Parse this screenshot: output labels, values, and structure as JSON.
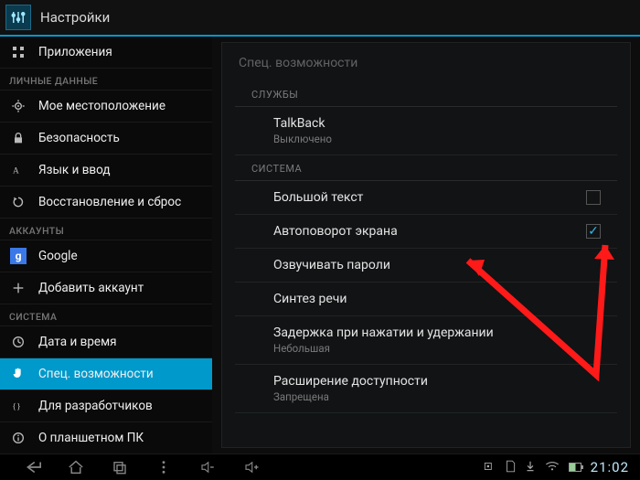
{
  "titlebar": {
    "title": "Настройки"
  },
  "sidebar": {
    "items": [
      {
        "label": "Приложения",
        "icon": "apps"
      }
    ],
    "section_personal": "ЛИЧНЫЕ ДАННЫЕ",
    "personal": [
      {
        "label": "Мое местоположение",
        "icon": "location"
      },
      {
        "label": "Безопасность",
        "icon": "lock"
      },
      {
        "label": "Язык и ввод",
        "icon": "lang"
      },
      {
        "label": "Восстановление и сброс",
        "icon": "reset"
      }
    ],
    "section_accounts": "АККАУНТЫ",
    "accounts": [
      {
        "label": "Google",
        "icon": "google"
      },
      {
        "label": "Добавить аккаунт",
        "icon": "plus"
      }
    ],
    "section_system": "СИСТЕМА",
    "system": [
      {
        "label": "Дата и время",
        "icon": "clock"
      },
      {
        "label": "Спец. возможности",
        "icon": "hand",
        "selected": true
      },
      {
        "label": "Для разработчиков",
        "icon": "dev"
      },
      {
        "label": "О планшетном ПК",
        "icon": "about"
      }
    ]
  },
  "content": {
    "page_title": "Спец. возможности",
    "section_services": "СЛУЖБЫ",
    "services": [
      {
        "primary": "TalkBack",
        "secondary": "Выключено"
      }
    ],
    "section_system": "СИСТЕМА",
    "system": [
      {
        "primary": "Большой текст",
        "checkbox": true,
        "checked": false
      },
      {
        "primary": "Автоповорот экрана",
        "checkbox": true,
        "checked": true
      },
      {
        "primary": "Озвучивать пароли"
      },
      {
        "primary": "Синтез речи"
      },
      {
        "primary": "Задержка при нажатии и удержании",
        "secondary": "Небольшая"
      },
      {
        "primary": "Расширение доступности",
        "secondary": "Запрещена"
      }
    ]
  },
  "navbar": {
    "time": "21:02"
  },
  "colors": {
    "accent": "#33b5e5",
    "holo_blue": "#0099cc",
    "arrow": "#ff1a1a"
  }
}
